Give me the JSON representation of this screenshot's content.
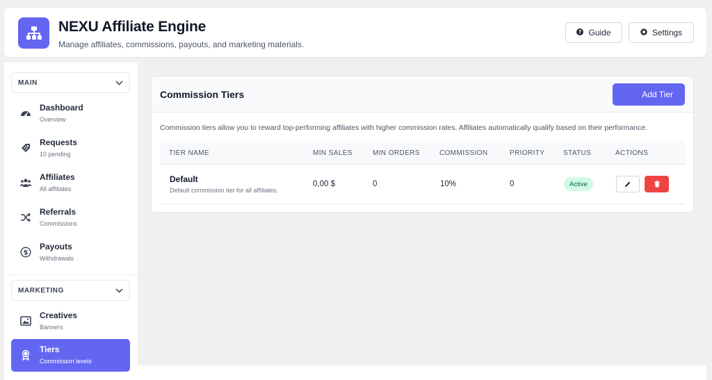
{
  "header": {
    "title": "NEXU Affiliate Engine",
    "subtitle": "Manage affiliates, commissions, payouts, and marketing materials.",
    "logo_icon": "sitemap-icon",
    "guide_label": "Guide",
    "settings_label": "Settings"
  },
  "sidebar": {
    "main_section": "MAIN",
    "marketing_section": "MARKETING",
    "main_items": [
      {
        "label": "Dashboard",
        "sub": "Overview",
        "icon": "gauge-icon"
      },
      {
        "label": "Requests",
        "sub": "10 pending",
        "icon": "tags-icon"
      },
      {
        "label": "Affiliates",
        "sub": "All affiliates",
        "icon": "users-icon"
      },
      {
        "label": "Referrals",
        "sub": "Commissions",
        "icon": "shuffle-icon"
      },
      {
        "label": "Payouts",
        "sub": "Withdrawals",
        "icon": "dollar-circle-icon"
      }
    ],
    "marketing_items": [
      {
        "label": "Creatives",
        "sub": "Banners",
        "icon": "image-icon"
      },
      {
        "label": "Tiers",
        "sub": "Commission levels",
        "icon": "award-icon",
        "active": true
      }
    ]
  },
  "main": {
    "title": "Commission Tiers",
    "add_label": "Add Tier",
    "description": "Commission tiers allow you to reward top-performing affiliates with higher commission rates. Affiliates automatically qualify based on their performance.",
    "columns": [
      "TIER NAME",
      "MIN SALES",
      "MIN ORDERS",
      "COMMISSION",
      "PRIORITY",
      "STATUS",
      "ACTIONS"
    ],
    "rows": [
      {
        "name": "Default",
        "description": "Default commission tier for all affiliates.",
        "min_sales": "0,00 $",
        "min_orders": "0",
        "commission": "10%",
        "priority": "0",
        "status": "Active"
      }
    ]
  },
  "colors": {
    "accent": "#6366f1",
    "danger": "#ef4444",
    "success_bg": "#d1fae5",
    "success_text": "#065f46"
  }
}
